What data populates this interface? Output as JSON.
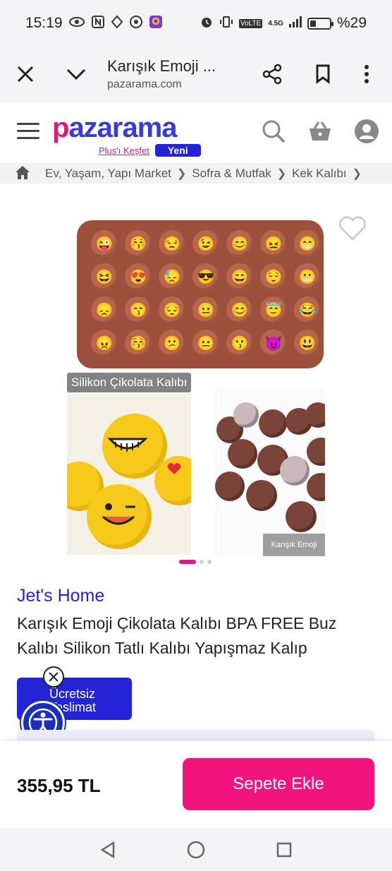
{
  "status_bar": {
    "time": "15:19",
    "volte": "VoLTE",
    "network": "4.5G",
    "battery": "%29",
    "battery_level": 0.29
  },
  "browser": {
    "page_title": "Karışık Emoji ...",
    "url": "pazarama.com"
  },
  "site_header": {
    "logo_text_first": "p",
    "logo_text_rest": "azarama",
    "plus_link": "Plus'ı Keşfet",
    "new_badge": "Yeni"
  },
  "breadcrumb": [
    "Ev, Yaşam, Yapı Market",
    "Sofra & Mutfak",
    "Kek Kalıbı"
  ],
  "gallery": {
    "caption": "Silikon Çikolata Kalıbı",
    "inner_label": "Karışık Emoji",
    "mold_emojis": [
      "😜",
      "😚",
      "😒",
      "😉",
      "😊",
      "😖",
      "😁",
      "😆",
      "😍",
      "😓",
      "😎",
      "😄",
      "😌",
      "😬",
      "😞",
      "😙",
      "😔",
      "😐",
      "😊",
      "😇",
      "😂",
      "😠",
      "😚",
      "😕",
      "😐",
      "😗",
      "😈",
      "😃"
    ]
  },
  "product": {
    "brand": "Jet's Home",
    "title": "Karışık Emoji Çikolata Kalıbı BPA FREE Buz Kalıbı Silikon Tatlı Kalıbı Yapışmaz Kalıp",
    "free_shipping_line1": "Ücretsiz",
    "free_shipping_line2": "Teslimat"
  },
  "purchase": {
    "price": "355,95 TL",
    "add_to_cart": "Sepete Ekle"
  },
  "colors": {
    "brand_blue": "#2424d6",
    "brand_pink": "#e6157a",
    "cart_button": "#f0147c"
  }
}
